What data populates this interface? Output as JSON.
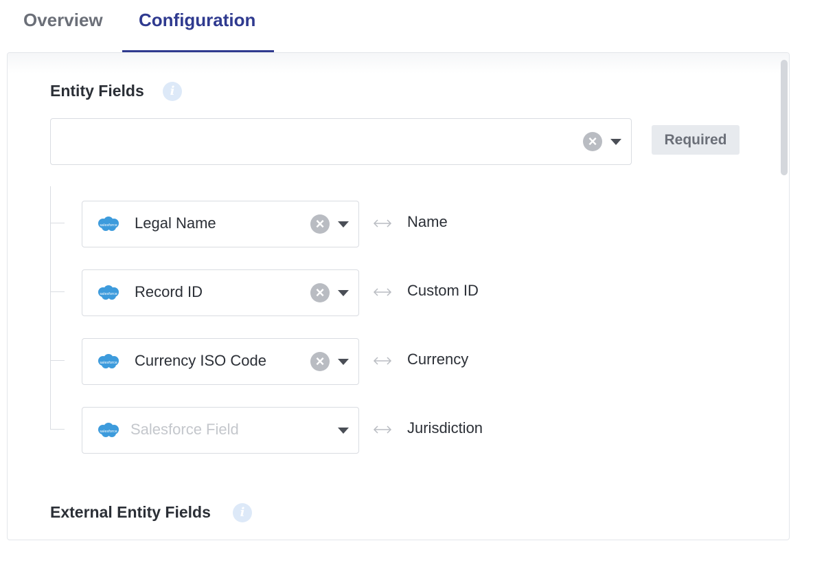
{
  "tabs": [
    {
      "label": "Overview",
      "active": false
    },
    {
      "label": "Configuration",
      "active": true
    }
  ],
  "accent_color": "#2f3a8f",
  "entity_fields": {
    "title": "Entity Fields",
    "info_icon": "info-icon",
    "top_select": {
      "value": ""
    },
    "required_label": "Required",
    "mappings": [
      {
        "source": "Legal Name",
        "target": "Name",
        "placeholder": false
      },
      {
        "source": "Record ID",
        "target": "Custom ID",
        "placeholder": false
      },
      {
        "source": "Currency ISO Code",
        "target": "Currency",
        "placeholder": false
      },
      {
        "source": "Salesforce Field",
        "target": "Jurisdiction",
        "placeholder": true
      }
    ],
    "source_icon": "salesforce-cloud-icon",
    "mapping_icon": "bidirectional-arrow-icon"
  },
  "external_entity_fields": {
    "title": "External Entity Fields",
    "info_icon": "info-icon"
  }
}
